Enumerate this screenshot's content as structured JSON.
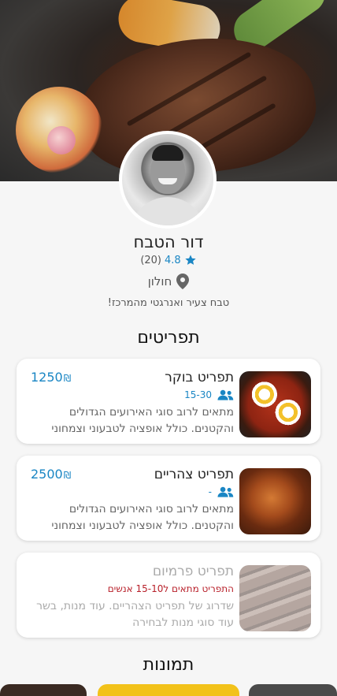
{
  "chef": {
    "name": "דור הטבח",
    "rating_score": "4.8",
    "rating_count": "(20)",
    "location": "חולון",
    "bio": "טבח צעיר ואנרגטי מהמרכז!"
  },
  "sections": {
    "menus_title": "תפריטים",
    "photos_title": "תמונות"
  },
  "menus": [
    {
      "title": "תפריט בוקר",
      "price": "1250",
      "currency": "₪",
      "guests": "15-30",
      "description": "מתאים לרוב סוגי האירועים הגדולים והקטנים. כולל אופציה לטבעוני וצמחוני",
      "thumb_icon": "shakshuka-image"
    },
    {
      "title": "תפריט צהריים",
      "price": "2500",
      "currency": "₪",
      "guests": "-",
      "description": "מתאים לרוב סוגי האירועים הגדולים והקטנים. כולל אופציה לטבעוני וצמחוני",
      "thumb_icon": "roast-chicken-image"
    },
    {
      "title": "תפריט פרמיום",
      "note": "התפריט מתאים ל15-10 אנשים",
      "description": "שדרוג של תפריט הצהריים. עוד מנות, בשר עוד סוגי מנות לבחירה",
      "thumb_icon": "sliced-steak-image",
      "disabled": true
    }
  ],
  "colors": {
    "accent": "#1a86c4",
    "warning": "#b8202a",
    "background": "#f6f6f6"
  }
}
